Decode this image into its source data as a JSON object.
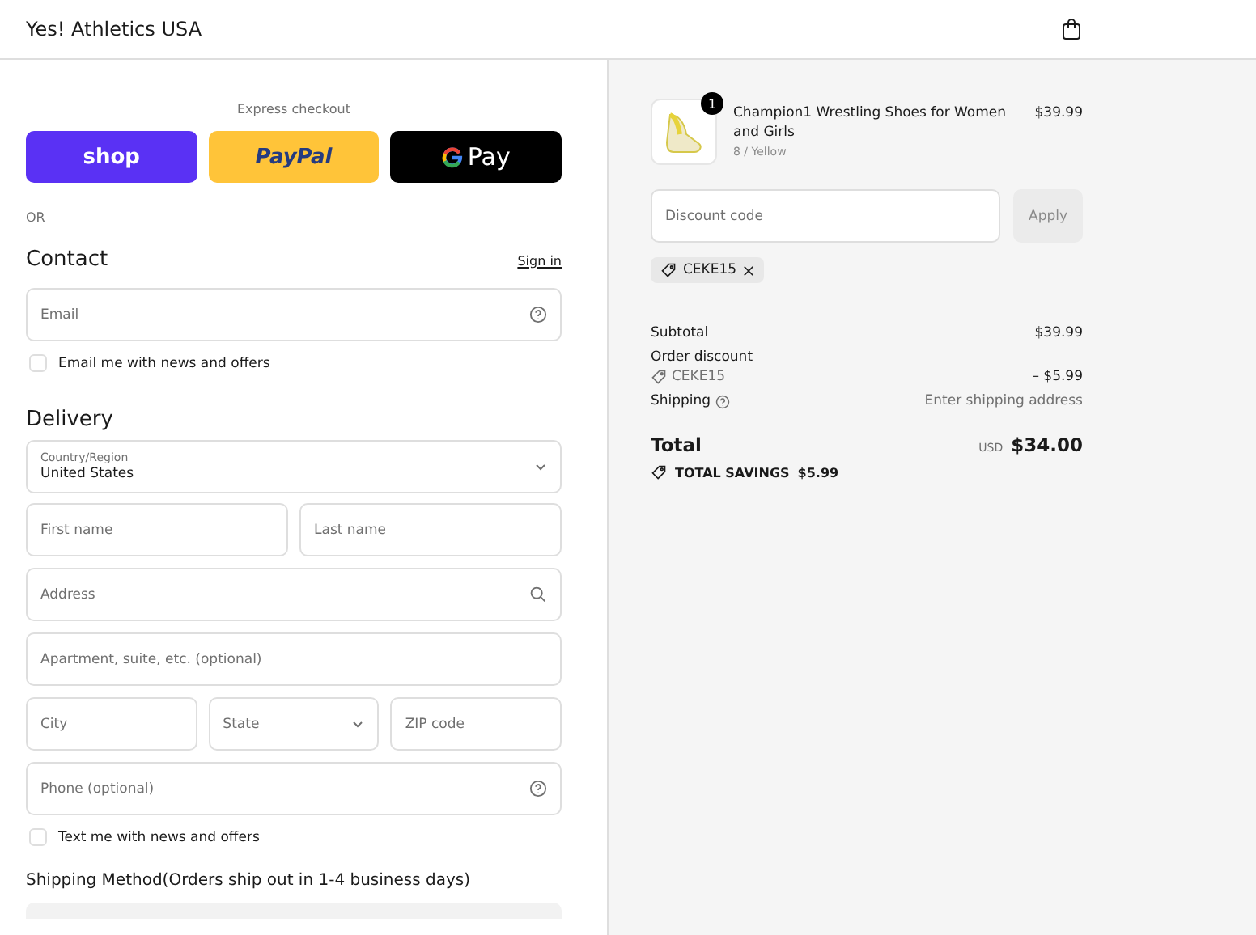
{
  "header": {
    "store_name": "Yes! Athletics USA"
  },
  "express": {
    "title": "Express checkout",
    "buttons": [
      {
        "kind": "shop",
        "label": "shop"
      },
      {
        "kind": "paypal",
        "label": "PayPal"
      },
      {
        "kind": "gpay",
        "label": "Pay"
      }
    ],
    "divider": "OR"
  },
  "contact": {
    "title": "Contact",
    "link": "Sign in",
    "email": {
      "placeholder": "Email"
    },
    "newsletter": {
      "label": "Email me with news and offers",
      "checked": false
    }
  },
  "delivery": {
    "title": "Delivery",
    "country": {
      "label": "Country/Region",
      "value": "United States"
    },
    "fields": [
      [
        {
          "kind": "text",
          "placeholder": "First name"
        },
        {
          "kind": "text",
          "placeholder": "Last name"
        }
      ],
      [
        {
          "kind": "search",
          "placeholder": "Address"
        }
      ],
      [
        {
          "kind": "text",
          "placeholder": "Apartment, suite, etc. (optional)"
        }
      ],
      [
        {
          "kind": "text",
          "placeholder": "City"
        },
        {
          "kind": "select",
          "placeholder": "State"
        },
        {
          "kind": "text",
          "placeholder": "ZIP code"
        }
      ],
      [
        {
          "kind": "help",
          "placeholder": "Phone (optional)"
        }
      ]
    ],
    "sms": {
      "label": "Text me with news and offers",
      "checked": false
    }
  },
  "shipping": {
    "title": "Shipping Method(Orders ship out in 1-4 business days)"
  },
  "summary": {
    "item": {
      "quantity": "1",
      "name": "Champion1 Wrestling Shoes for Women and Girls",
      "variant": "8 / Yellow",
      "price": "$39.99"
    },
    "discount": {
      "placeholder": "Discount code",
      "button": "Apply"
    },
    "applied_code": "CEKE15",
    "lines": [
      {
        "kind": "plain",
        "label": "Subtotal",
        "value": "$39.99"
      },
      {
        "kind": "discount",
        "label": "Order discount",
        "code": "CEKE15",
        "value": "– $5.99"
      },
      {
        "kind": "help",
        "label": "Shipping",
        "value": "Enter shipping address"
      }
    ],
    "total": {
      "label": "Total",
      "currency": "USD",
      "value": "$34.00"
    },
    "savings": {
      "label": "TOTAL SAVINGS",
      "value": "$5.99"
    }
  }
}
